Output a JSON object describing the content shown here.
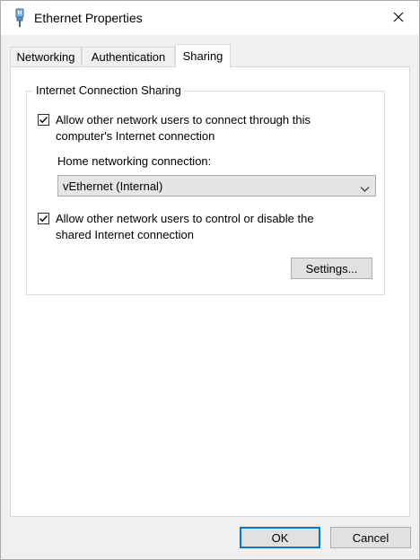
{
  "window": {
    "title": "Ethernet Properties",
    "icon": "ethernet-adapter-icon",
    "close_icon": "close-icon"
  },
  "tabs": [
    {
      "label": "Networking",
      "active": false
    },
    {
      "label": "Authentication",
      "active": false
    },
    {
      "label": "Sharing",
      "active": true
    }
  ],
  "sharing": {
    "group_title": "Internet Connection Sharing",
    "allow_connect": {
      "label": "Allow other network users to connect through this computer's Internet connection",
      "checked": true
    },
    "home_network_label": "Home networking connection:",
    "home_network_value": "vEthernet (Internal)",
    "allow_control": {
      "label": "Allow other network users to control or disable the shared Internet connection",
      "checked": true
    },
    "settings_button": "Settings..."
  },
  "footer": {
    "ok": "OK",
    "cancel": "Cancel"
  },
  "colors": {
    "accent": "#0078d7",
    "window_bg": "#f0f0f0",
    "panel_bg": "#ffffff"
  }
}
